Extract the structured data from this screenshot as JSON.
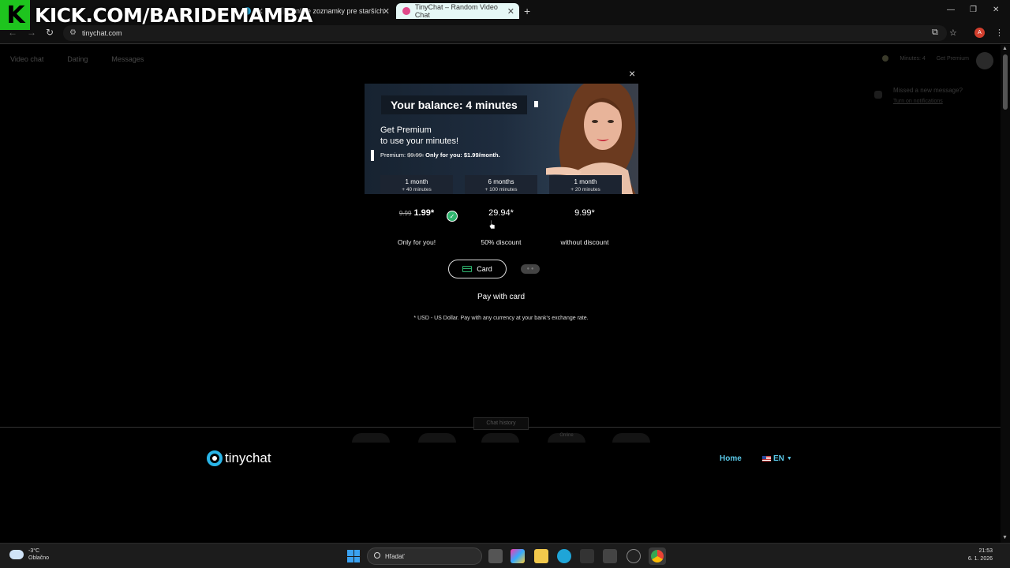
{
  "overlay": {
    "streamer_logo": "K",
    "streamer_url": "KICK.COM/BARIDEMAMBA"
  },
  "browser": {
    "tabs": [
      {
        "label": ""
      },
      {
        "label": "Online zoznamky pre starších"
      },
      {
        "label": "TinyChat – Random Video Chat"
      }
    ],
    "new_tab": "+",
    "url": "tinychat.com",
    "profile_initial": "A",
    "window_controls": [
      "—",
      "❐",
      "✕"
    ]
  },
  "site_nav": {
    "items": [
      "Video chat",
      "Dating",
      "Messages"
    ],
    "minutes_label": "Minutes: 4",
    "get_premium": "Get Premium",
    "notification": {
      "title": "Missed a new message?",
      "action": "Turn on notifications"
    }
  },
  "modal": {
    "close": "×",
    "balance": "Your balance: 4 minutes",
    "heading_line1": "Get Premium",
    "heading_line2": "to use your minutes!",
    "promo_prefix": "Premium: ",
    "promo_old": "$9.99.",
    "promo_text": " Only for you: $1.99/month.",
    "plans": [
      {
        "duration": "1 month",
        "bonus": "+ 40 minutes",
        "old_price": "9.99",
        "price": "1.99*",
        "desc": "Only for you!",
        "selected": true
      },
      {
        "duration": "6 months",
        "bonus": "+ 100 minutes",
        "old_price": "",
        "price": "29.94*",
        "desc": "50% discount",
        "selected": false
      },
      {
        "duration": "1 month",
        "bonus": "+ 20 minutes",
        "old_price": "",
        "price": "9.99*",
        "desc": "without discount",
        "selected": false
      }
    ],
    "card_button": "Card",
    "pay_with_card": "Pay with card",
    "currency_note": "* USD - US Dollar. Pay with any currency at your bank's exchange rate."
  },
  "footer": {
    "chat_history": "Chat history",
    "online_badge": "Online",
    "logo_text": "tinychat",
    "home": "Home",
    "language": "EN",
    "accent_color": "#5ac8e8"
  },
  "taskbar": {
    "weather_temp": "-3°C",
    "weather_desc": "Oblačno",
    "search_placeholder": "Hľadať",
    "time": "21:53",
    "date": "6. 1. 2026"
  }
}
